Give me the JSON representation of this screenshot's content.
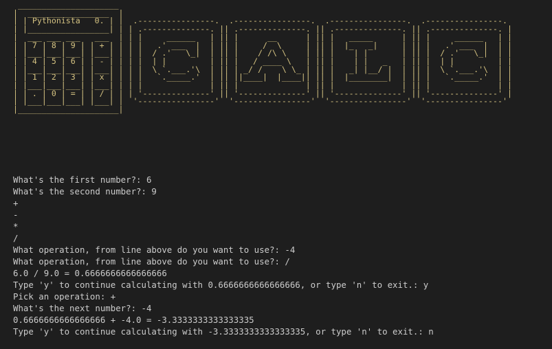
{
  "terminal": {
    "ascii_art": " _____________________\n|  _________________  |\n| | Pythonista   0. | |  .----------------.  .----------------.  .----------------.  .----------------.\n| |_________________| | | .--------------. || .--------------. || .--------------. || .--------------. |\n|  ___ ___ ___   ___  | | |     ______   | || |      __      | || |   _____      | || |     ______   | |\n| | 7 | 8 | 9 | | + | | | |   .' ___  |  | || |     /  \\     | || |  |_   _|     | || |   .' ___  |  | |\n| |___|___|___| |___| | | |  / .'   \\_|  | || |    / /\\ \\    | || |    | |       | || |  / .'   \\_|  | |\n| | 4 | 5 | 6 | | - | | | |  | |         | || |   / ____ \\   | || |    | |   _   | || |  | |         | |\n| |___|___|___| |___| | | |  \\ `.___.'\\  | || | _/ /    \\ \\_ | || |   _| |__/ |  | || |  \\ `.___.'\\  | |\n| | 1 | 2 | 3 | | x | | | |   `._____.'  | || ||____|  |____|| || |  |________|  | || |   `._____.'  | |\n| |___|___|___| |___| | | |              | || |              | || |              | || |              | |\n| | . | 0 | = | | / | | | '--------------' || '--------------' || '--------------' || '--------------' |\n| |___|___|___| |___| |  '----------------'  '----------------'  '----------------'  '----------------'\n|_____________________|",
    "lines": [
      "What's the first number?: 6",
      "What's the second number?: 9",
      "+",
      "-",
      "*",
      "/",
      "What operation, from line above do you want to use?: -4",
      "What operation, from line above do you want to use?: /",
      "6.0 / 9.0 = 0.6666666666666666",
      "Type 'y' to continue calculating with 0.6666666666666666, or type 'n' to exit.: y",
      "Pick an operation: +",
      "What's the next number?: -4",
      "0.6666666666666666 + -4.0 = -3.3333333333333335",
      "Type 'y' to continue calculating with -3.3333333333333335, or type 'n' to exit.: n"
    ]
  },
  "colors": {
    "background": "#1e1e1e",
    "ascii": "#d4c281",
    "text": "#cccccc"
  }
}
